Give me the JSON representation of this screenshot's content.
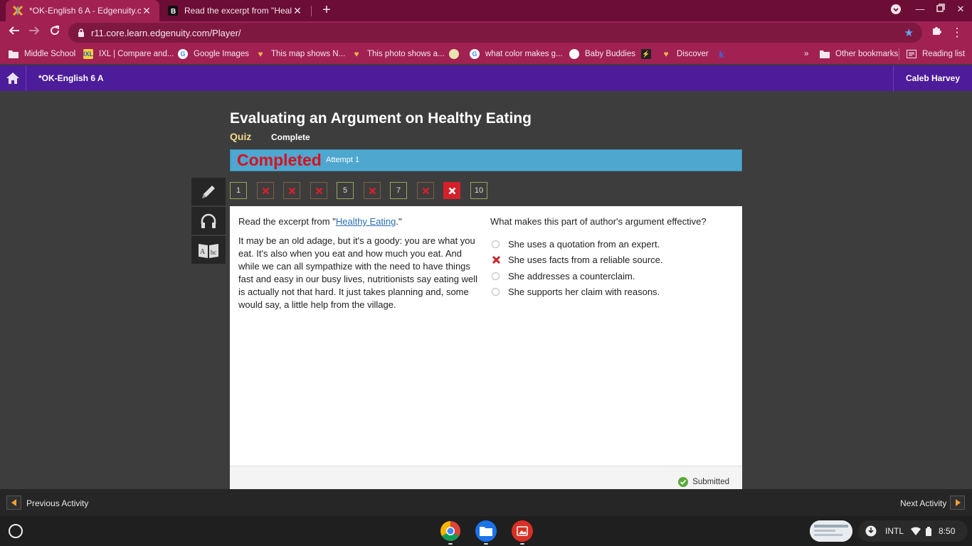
{
  "browser": {
    "tabs": [
      {
        "title": "*OK-English 6 A - Edgenuity.com",
        "active": true
      },
      {
        "title": "Read the excerpt from \"Healthy E",
        "active": false
      }
    ],
    "url": "r11.core.learn.edgenuity.com/Player/",
    "bookmarks": [
      {
        "label": "Middle School",
        "icon": "folder-icon"
      },
      {
        "label": "IXL | Compare and...",
        "icon": "ixl-icon"
      },
      {
        "label": "Google Images",
        "icon": "google-icon"
      },
      {
        "label": "This map shows N...",
        "icon": "brainly-icon"
      },
      {
        "label": "This photo shows a...",
        "icon": "brainly-icon"
      },
      {
        "label": "",
        "icon": "site-icon"
      },
      {
        "label": "what color makes g...",
        "icon": "google-icon"
      },
      {
        "label": "Baby Buddies",
        "icon": "site-icon"
      },
      {
        "label": "",
        "icon": "site-icon"
      },
      {
        "label": "Discover",
        "icon": "brainly-icon"
      },
      {
        "label": "",
        "icon": "site-icon"
      }
    ],
    "other_bookmarks": "Other bookmarks",
    "reading_list": "Reading list",
    "overflow": "»"
  },
  "header": {
    "course_title": "*OK-English 6 A",
    "user_name": "Caleb Harvey"
  },
  "lesson": {
    "title": "Evaluating an Argument on Healthy Eating",
    "type": "Quiz",
    "status": "Complete"
  },
  "banner": {
    "status": "Completed",
    "attempt": "Attempt 1"
  },
  "question_nav": [
    {
      "label": "1",
      "state": "correct"
    },
    {
      "label": "",
      "state": "wrong"
    },
    {
      "label": "",
      "state": "wrong"
    },
    {
      "label": "",
      "state": "wrong"
    },
    {
      "label": "5",
      "state": "correct"
    },
    {
      "label": "",
      "state": "wrong"
    },
    {
      "label": "7",
      "state": "correct"
    },
    {
      "label": "",
      "state": "wrong"
    },
    {
      "label": "",
      "state": "current-wrong"
    },
    {
      "label": "10",
      "state": "correct"
    }
  ],
  "content": {
    "lead_before": "Read the excerpt from \"",
    "link_text": "Healthy Eating",
    "lead_after": ".\"",
    "passage": "It may be an old adage, but it's a goody: you are what you eat. It's also when you eat and how much you eat. And while we can all sympathize with the need to have things fast and easy in our busy lives, nutritionists say eating well is actually not that hard. It just takes planning and, some would say, a little help from the village.",
    "question": "What makes this part of author's argument effective?",
    "options": [
      {
        "label": "She uses a quotation from an expert.",
        "selected": false
      },
      {
        "label": "She uses facts from a reliable source.",
        "selected": true,
        "marked": "incorrect"
      },
      {
        "label": "She addresses a counterclaim.",
        "selected": false
      },
      {
        "label": "She supports her claim with reasons.",
        "selected": false
      }
    ],
    "submitted": "Submitted"
  },
  "activity_bar": {
    "previous": "Previous Activity",
    "next": "Next Activity"
  },
  "shelf": {
    "ime": "INTL",
    "time": "8:50"
  },
  "colors": {
    "chrome_frame": "#6b0d34",
    "chrome_toolbar": "#a02152",
    "edgenuity_header": "#4c1c9a",
    "banner": "#4da7cf",
    "completed_text": "#d9101f",
    "wrong_mark": "#d42029"
  }
}
